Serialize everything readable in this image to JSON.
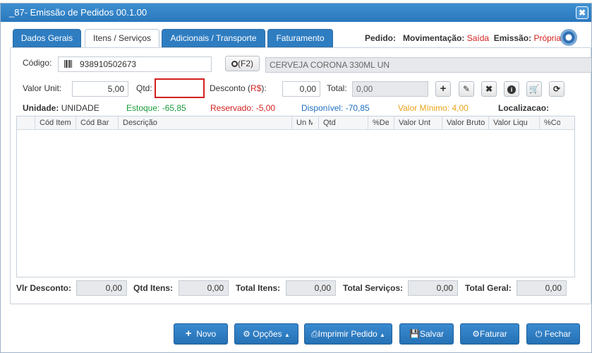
{
  "window": {
    "title": "_87- Emissão de Pedidos 00.1.00",
    "close_glyph": "✖"
  },
  "tabs": [
    {
      "label": "Dados Gerais"
    },
    {
      "label": "Itens / Serviços"
    },
    {
      "label": "Adicionais / Transporte"
    },
    {
      "label": "Faturamento"
    }
  ],
  "header": {
    "pedido_label": "Pedido:",
    "movimentacao_label": "Movimentação:",
    "movimentacao_value": "Saída",
    "emissao_label": "Emissão:",
    "emissao_value": "Própria"
  },
  "item": {
    "codigo_label": "Código:",
    "codigo_value": "938910502673",
    "search_label": "(F2)",
    "descricao_value": "CERVEJA CORONA 330ML UN",
    "valor_unit_label": "Valor Unit:",
    "valor_unit_value": "5,00",
    "qtd_label": "Qtd:",
    "qtd_value": "",
    "desconto_label": "Desconto (",
    "desconto_currency": "R$",
    "desconto_suffix": "):",
    "desconto_value": "0,00",
    "total_label": "Total:",
    "total_value": "0,00"
  },
  "stats": {
    "unidade_label": "Unidade:",
    "unidade_value": "UNIDADE",
    "estoque": "Estoque: -65,85",
    "reservado": "Reservado: -5,00",
    "disponivel": "Disponível: -70,85",
    "valor_minimo": "Valor Mínimo: 4,00",
    "localizacao": "Localizacao:"
  },
  "grid": {
    "columns": [
      "Cód Item",
      "Cód Bar",
      "Descrição",
      "Un M",
      "Qtd",
      "%De",
      "Valor Unt",
      "Valor Bruto",
      "Valor Liqu",
      "%Co"
    ]
  },
  "totals": {
    "vlr_desconto_label": "Vlr Desconto:",
    "vlr_desconto_value": "0,00",
    "qtd_itens_label": "Qtd Itens:",
    "qtd_itens_value": "0,00",
    "total_itens_label": "Total Itens:",
    "total_itens_value": "0,00",
    "total_servicos_label": "Total Serviços:",
    "total_servicos_value": "0,00",
    "total_geral_label": "Total Geral:",
    "total_geral_value": "0,00"
  },
  "buttons": {
    "novo": "Novo",
    "opcoes": "Opções",
    "imprimir": "Imprimir Pedido",
    "salvar": "Salvar",
    "faturar": "Faturar",
    "fechar": "Fechar"
  },
  "colors": {
    "accent": "#2f7dc1",
    "estoque": "#1a9c3a",
    "reservado": "#d32020",
    "disponivel": "#1f6fc0",
    "valor_minimo": "#e8a317"
  }
}
